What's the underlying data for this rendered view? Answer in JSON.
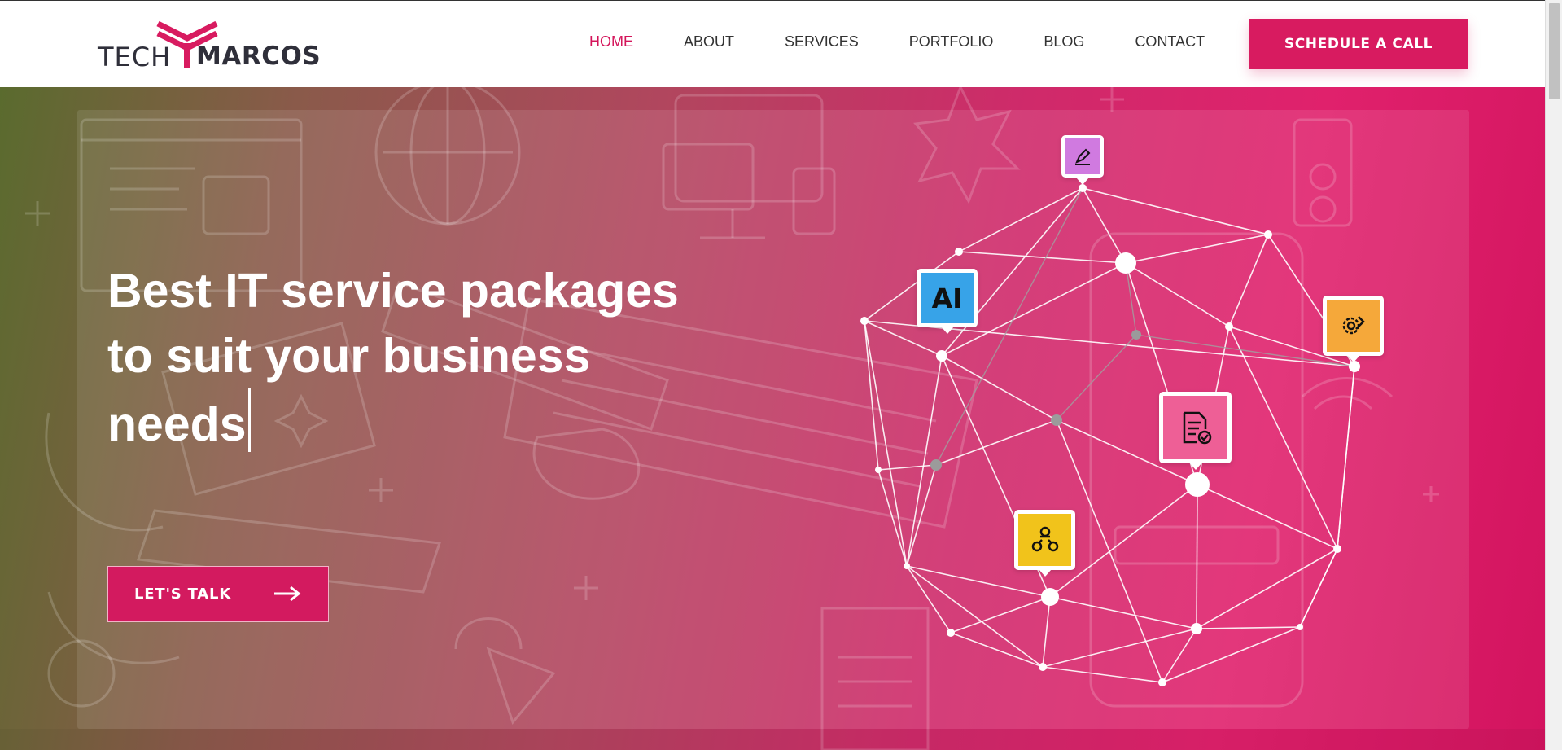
{
  "brand": {
    "tech": "TECH",
    "marcos": "MARCOS",
    "accent": "#d81b60"
  },
  "nav": {
    "items": [
      {
        "label": "HOME",
        "active": true
      },
      {
        "label": "ABOUT",
        "active": false
      },
      {
        "label": "SERVICES",
        "active": false
      },
      {
        "label": "PORTFOLIO",
        "active": false
      },
      {
        "label": "BLOG",
        "active": false
      },
      {
        "label": "CONTACT",
        "active": false
      }
    ],
    "cta": "SCHEDULE A CALL"
  },
  "hero": {
    "headline_line1": "Best IT service packages",
    "headline_line2": "to suit your business",
    "headline_line3": "needs",
    "button": "LET'S TALK",
    "button_icon": "arrow-right-icon"
  },
  "network_tags": {
    "ai_label": "AI",
    "icons": [
      "pen-icon",
      "ai-icon",
      "gear-wrench-icon",
      "document-check-icon",
      "team-network-icon"
    ]
  }
}
